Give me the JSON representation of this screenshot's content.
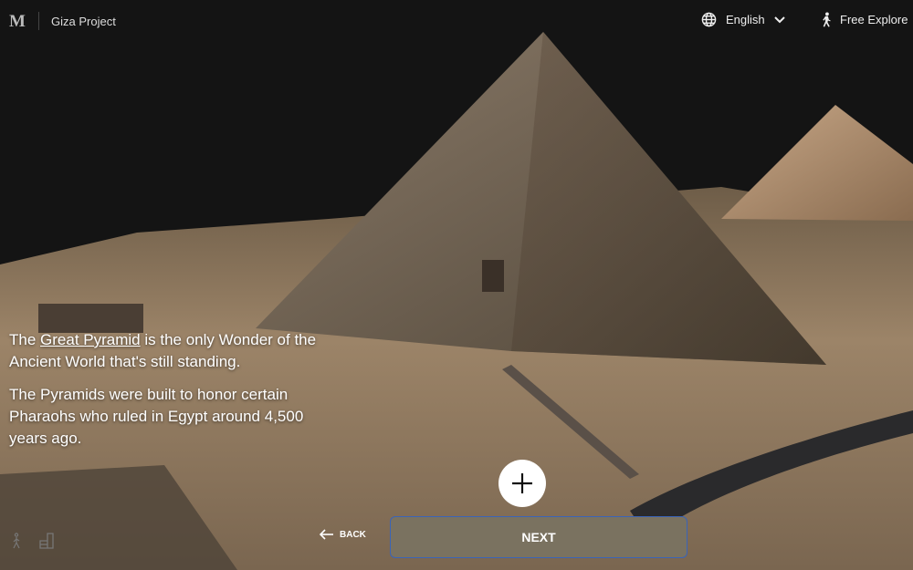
{
  "header": {
    "logo": "M",
    "project": "Giza Project",
    "language": "English",
    "free_explore": "Free Explore"
  },
  "caption": {
    "p1_before": "The ",
    "p1_link": "Great Pyramid",
    "p1_after": " is the only Wonder of the Ancient World that's still standing.",
    "p2": "The Pyramids were built to honor certain Pharaohs who ruled in Egypt around 4,500 years ago."
  },
  "controls": {
    "back": "BACK",
    "next": "NEXT"
  },
  "colors": {
    "next_bg": "#7a7260",
    "next_border": "#3a64b8",
    "sky": "#141414"
  }
}
